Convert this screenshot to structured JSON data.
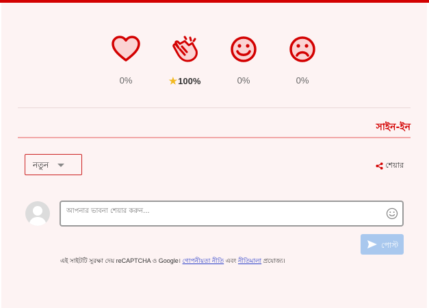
{
  "colors": {
    "accent": "#d30000",
    "post_button": "#a9c8ee",
    "panel_bg": "#fdf3f3"
  },
  "reactions": [
    {
      "icon": "heart-icon",
      "percent": "0%"
    },
    {
      "icon": "clap-icon",
      "percent": "100%",
      "selected": true
    },
    {
      "icon": "smile-icon",
      "percent": "0%"
    },
    {
      "icon": "sad-icon",
      "percent": "0%"
    }
  ],
  "header": {
    "signin_label": "সাইন-ইন"
  },
  "toolbar": {
    "sort_label": "নতুন",
    "share_label": "শেয়ার"
  },
  "composer": {
    "placeholder": "আপনার ভাবনা শেয়ার করুন...",
    "post_label": "পোস্ট"
  },
  "notice": {
    "prefix": "এই সাইটটি সুরক্ষা দেয় reCAPTCHA ও Google।",
    "privacy_link": "গোপনীয়তা নীতি",
    "conjunction": "এবং",
    "terms_link": "নীতিমালা",
    "suffix": "প্রযোজ্য।"
  }
}
